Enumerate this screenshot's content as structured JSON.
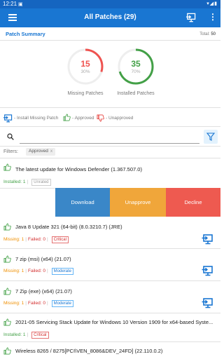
{
  "status_bar": {
    "time": "12:21",
    "sim_icon": "sim-card-icon"
  },
  "app_bar": {
    "title": "All Patches (29)"
  },
  "summary": {
    "label": "Patch Summary",
    "total_label": "Total:",
    "total_value": "50",
    "missing": {
      "count": "15",
      "percent": "30%",
      "label": "Missing Patches",
      "fraction": 0.3,
      "color": "#ef5350"
    },
    "installed": {
      "count": "35",
      "percent": "70%",
      "label": "Installed Patches",
      "fraction": 0.7,
      "color": "#43a047"
    }
  },
  "legend": {
    "install_missing": "- Install Missing Patch",
    "approved": "- Approved",
    "unapproved": "- Unapproved"
  },
  "search": {
    "placeholder": ""
  },
  "filters": {
    "label": "Filters:",
    "chip": "Approved",
    "chip_close": "x"
  },
  "patches": [
    {
      "name": "The latest update for Windows Defender (1.367.507.0)",
      "installed_label": "Installed:",
      "installed": "1",
      "severity": "Unrated"
    },
    {
      "name": "Java 8 Update 321 (64-bit) (8.0.3210.7) (JRE)",
      "missing_label": "Missing:",
      "missing": "1",
      "failed_label": "Failed:",
      "failed": "0",
      "severity": "Critical"
    },
    {
      "name": "7 zip (msi) (x64) (21.07)",
      "missing_label": "Missing:",
      "missing": "1",
      "failed_label": "Failed:",
      "failed": "0",
      "severity": "Moderate"
    },
    {
      "name": "7 Zip (exe) (x64) (21.07)",
      "missing_label": "Missing:",
      "missing": "1",
      "failed_label": "Failed:",
      "failed": "0",
      "severity": "Moderate"
    },
    {
      "name": "2021-05 Servicing Stack Update for Windows 10 Version 1909 for x64-based Syste...",
      "installed_label": "Installed:",
      "installed": "1",
      "severity": "Critical"
    },
    {
      "name": "Wireless 8265 / 8275[PCI\\VEN_8086&DEV_24FD] (22.110.0.2)"
    }
  ],
  "swipe_actions": {
    "download": "Download",
    "unapprove": "Unapprove",
    "decline": "Decline",
    "colors": {
      "download": "#3a87c8",
      "unapprove": "#f0a63a",
      "decline": "#ee5a50"
    }
  }
}
